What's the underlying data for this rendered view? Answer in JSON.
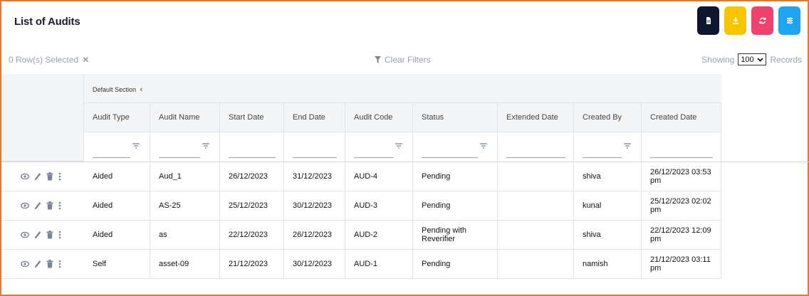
{
  "page": {
    "title": "List of Audits"
  },
  "actions": [
    {
      "name": "export-pdf-button",
      "icon": "document-icon",
      "color": "#0f1730"
    },
    {
      "name": "download-button",
      "icon": "download-icon",
      "color": "#f7c500"
    },
    {
      "name": "refresh-button",
      "icon": "refresh-icon",
      "color": "#f0416f"
    },
    {
      "name": "columns-button",
      "icon": "list-settings-icon",
      "color": "#1da5f2"
    }
  ],
  "toolbar": {
    "rows_selected": "0 Row(s) Selected",
    "clear_filters": "Clear Filters",
    "showing_label": "Showing",
    "page_size": "100",
    "records_label": "Records"
  },
  "table": {
    "section_label": "Default Section",
    "columns": [
      "Audit Type",
      "Audit Name",
      "Start Date",
      "End Date",
      "Audit Code",
      "Status",
      "Extended Date",
      "Created By",
      "Created Date"
    ],
    "filterable": [
      true,
      true,
      false,
      false,
      true,
      true,
      false,
      true,
      false
    ],
    "rows": [
      [
        "Aided",
        "Aud_1",
        "26/12/2023",
        "31/12/2023",
        "AUD-4",
        "Pending",
        "",
        "shiva",
        "26/12/2023 03:53 pm"
      ],
      [
        "Aided",
        "AS-25",
        "25/12/2023",
        "30/12/2023",
        "AUD-3",
        "Pending",
        "",
        "kunal",
        "25/12/2023 02:02 pm"
      ],
      [
        "Aided",
        "as",
        "22/12/2023",
        "26/12/2023",
        "AUD-2",
        "Pending with Reverifier",
        "",
        "shiva",
        "22/12/2023 12:09 pm"
      ],
      [
        "Self",
        "asset-09",
        "21/12/2023",
        "30/12/2023",
        "AUD-1",
        "Pending",
        "",
        "namish",
        "21/12/2023 03:11 pm"
      ]
    ]
  }
}
